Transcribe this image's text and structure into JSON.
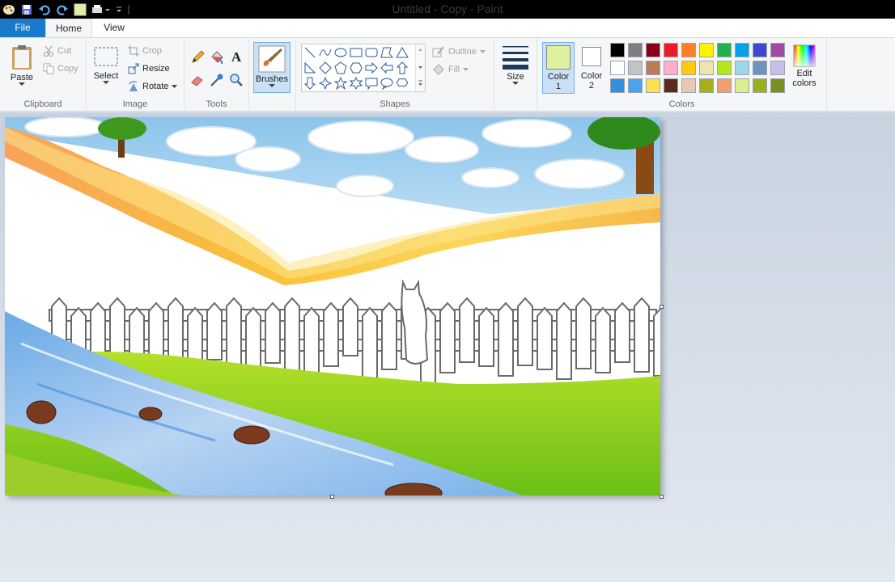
{
  "window": {
    "title": "Untitled - Copy - Paint"
  },
  "tabs": {
    "file": "File",
    "home": "Home",
    "view": "View"
  },
  "clipboard": {
    "paste": "Paste",
    "cut": "Cut",
    "copy": "Copy",
    "label": "Clipboard"
  },
  "image": {
    "select": "Select",
    "crop": "Crop",
    "resize": "Resize",
    "rotate": "Rotate",
    "label": "Image"
  },
  "tools": {
    "label": "Tools"
  },
  "brushes": {
    "label": "Brushes"
  },
  "shapes": {
    "outline": "Outline",
    "fill": "Fill",
    "label": "Shapes"
  },
  "size": {
    "label": "Size"
  },
  "colors": {
    "color1": "Color\n1",
    "color2": "Color\n2",
    "color1_value": "#dff0a0",
    "color2_value": "#ffffff",
    "edit": "Edit\ncolors",
    "label": "Colors",
    "palette": [
      "#000000",
      "#7f7f7f",
      "#880015",
      "#ed1c24",
      "#ff7f27",
      "#fff200",
      "#22b14c",
      "#00a2e8",
      "#3f48cc",
      "#a349a4",
      "#ffffff",
      "#c3c3c3",
      "#b97a57",
      "#ffaec9",
      "#ffc90e",
      "#efe4b0",
      "#b5e61d",
      "#99d9ea",
      "#7092be",
      "#c8bfe7",
      "#2f8fe0",
      "#4aa3ef",
      "#ffe050",
      "#5a2a1a",
      "#e6c8b4",
      "#a6b01e",
      "#f0a070",
      "#d8f090",
      "#9ab020",
      "#7a9020"
    ]
  }
}
